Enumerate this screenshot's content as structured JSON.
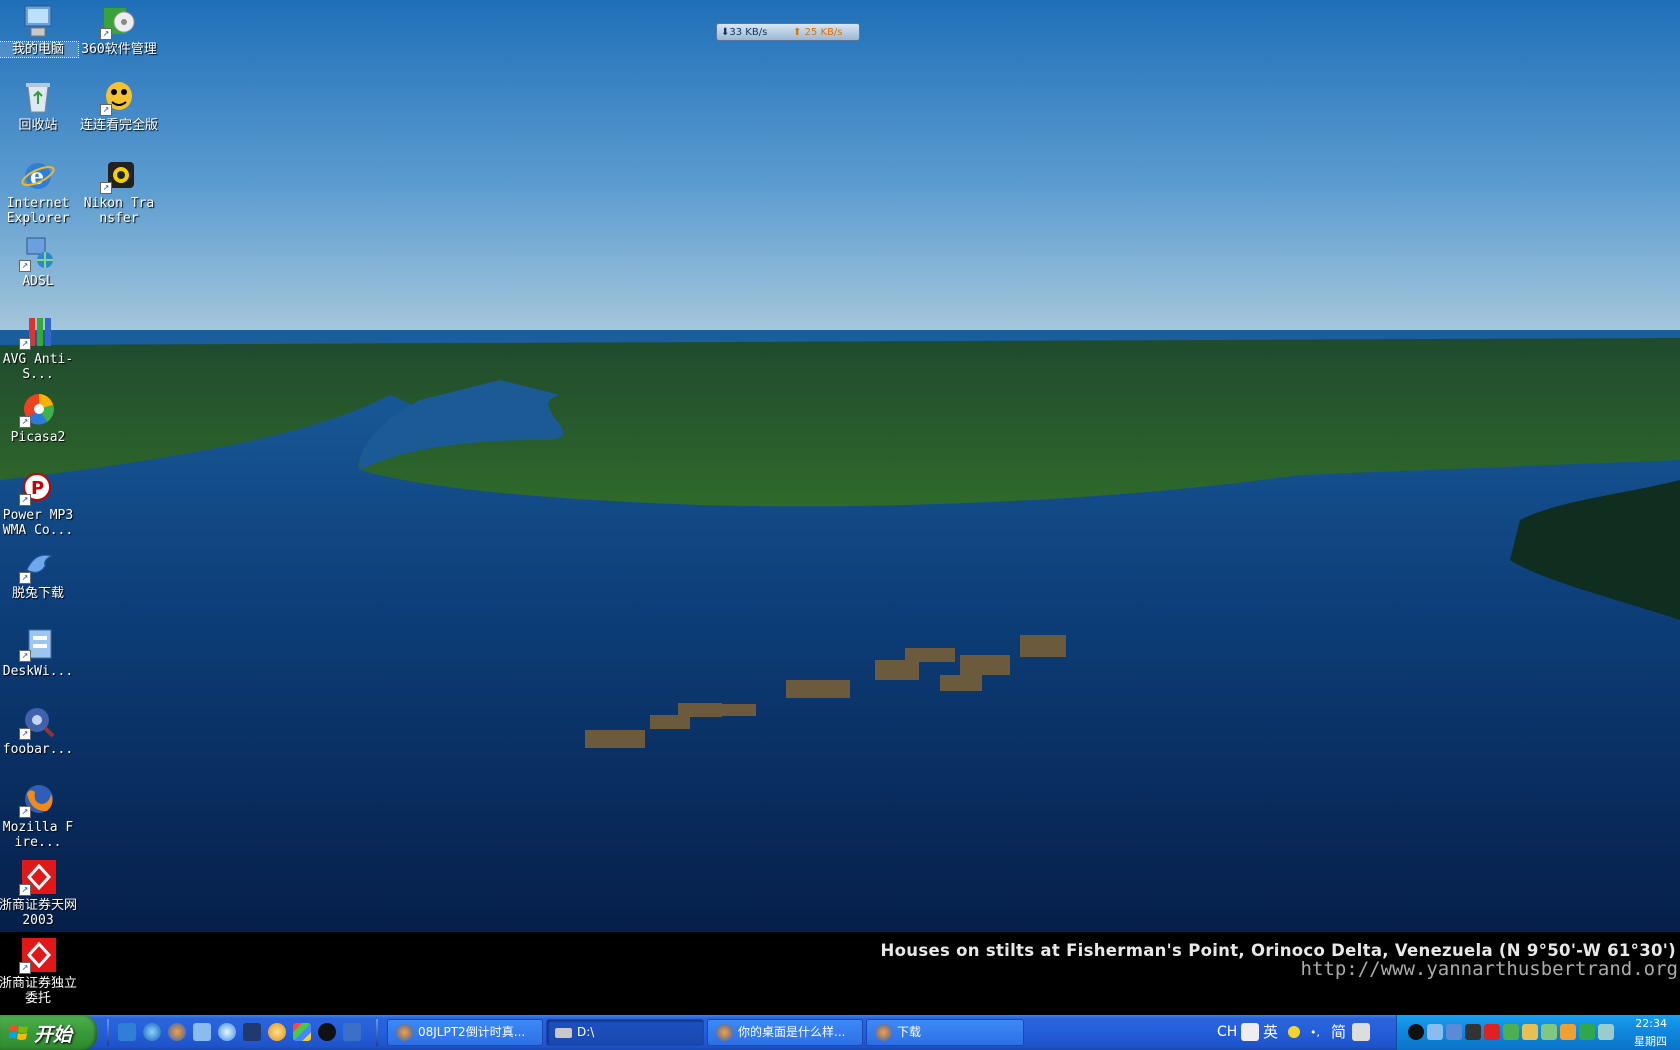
{
  "wallpaper": {
    "caption_title": "Houses on stilts at Fisherman's Point, Orinoco Delta, Venezuela (N 9°50'-W 61°30')",
    "caption_url": "http://www.yannarthusbertrand.org"
  },
  "net_monitor": {
    "download": "33 KB/s",
    "upload": "25 KB/s"
  },
  "desktop_icons": [
    {
      "label": "我的电脑",
      "icon": "my-computer-icon"
    },
    {
      "label": "360软件管理",
      "icon": "software-manager-icon"
    },
    {
      "label": "回收站",
      "icon": "recycle-bin-icon"
    },
    {
      "label": "连连看完全版",
      "icon": "game-icon"
    },
    {
      "label": "Internet Explorer",
      "icon": "internet-explorer-icon"
    },
    {
      "label": "Nikon Transfer",
      "icon": "nikon-transfer-icon"
    },
    {
      "label": "ADSL",
      "icon": "network-icon"
    },
    {
      "label": "AVG Anti-S...",
      "icon": "avg-icon"
    },
    {
      "label": "Picasa2",
      "icon": "picasa-icon"
    },
    {
      "label": "Power MP3 WMA Co...",
      "icon": "audio-converter-icon"
    },
    {
      "label": "脱兔下载",
      "icon": "download-manager-icon"
    },
    {
      "label": "DeskWi...",
      "icon": "deskwidget-icon"
    },
    {
      "label": "foobar...",
      "icon": "foobar-icon"
    },
    {
      "label": "Mozilla Fire...",
      "icon": "firefox-icon"
    },
    {
      "label": "浙商证券天网 2003",
      "icon": "stock-trading-icon"
    },
    {
      "label": "浙商证券独立委托",
      "icon": "stock-trading-icon"
    }
  ],
  "taskbar": {
    "start_label": "开始",
    "tasks": [
      {
        "label": "08JLPT2倒计时真...",
        "icon": "firefox-icon"
      },
      {
        "label": "D:\\",
        "icon": "drive-icon"
      },
      {
        "label": "你的桌面是什么样...",
        "icon": "firefox-icon"
      },
      {
        "label": "下载",
        "icon": "firefox-icon"
      }
    ],
    "language_bar": {
      "code": "CH",
      "mode": "英",
      "simplified": "简"
    },
    "clock": {
      "time": "22:34",
      "day": "星期四"
    }
  }
}
